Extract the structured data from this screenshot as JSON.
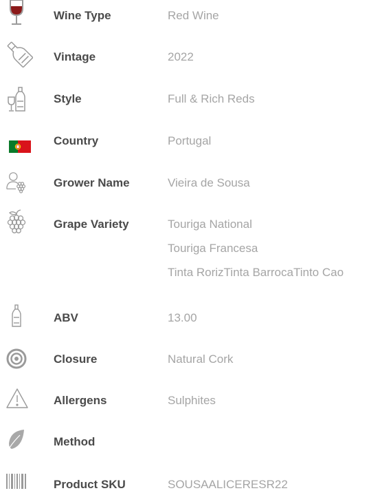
{
  "specs": [
    {
      "label": "Wine Type",
      "value": "Red Wine",
      "icon": "wine-glass-icon"
    },
    {
      "label": "Vintage",
      "value": "2022",
      "icon": "wine-bottle-icon"
    },
    {
      "label": "Style",
      "value": "Full & Rich Reds",
      "icon": "bottle-and-glass-icon"
    },
    {
      "label": "Country",
      "value": "Portugal",
      "icon": "portugal-flag-icon"
    },
    {
      "label": "Grower Name",
      "value": "Vieira de Sousa",
      "icon": "grower-icon"
    },
    {
      "label": "Grape Variety",
      "values": [
        "Touriga National",
        "Touriga Francesa",
        "Tinta RorizTinta BarrocaTinto Cao"
      ],
      "icon": "grapes-icon"
    },
    {
      "label": "ABV",
      "value": "13.00",
      "icon": "bottle-icon"
    },
    {
      "label": "Closure",
      "value": "Natural Cork",
      "icon": "cork-target-icon"
    },
    {
      "label": "Allergens",
      "value": "Sulphites",
      "icon": "warning-triangle-icon"
    },
    {
      "label": "Method",
      "value": "",
      "icon": "leaf-icon"
    },
    {
      "label": "Product SKU",
      "value": "SOUSAALICERESR22",
      "icon": "barcode-icon"
    }
  ],
  "colors": {
    "label": "#4a4a4a",
    "value": "#a5a5a5",
    "icon": "#9a9a9a",
    "wine": "#8b1a1a",
    "flag_green": "#0a7a2a",
    "flag_red": "#d9141b"
  }
}
